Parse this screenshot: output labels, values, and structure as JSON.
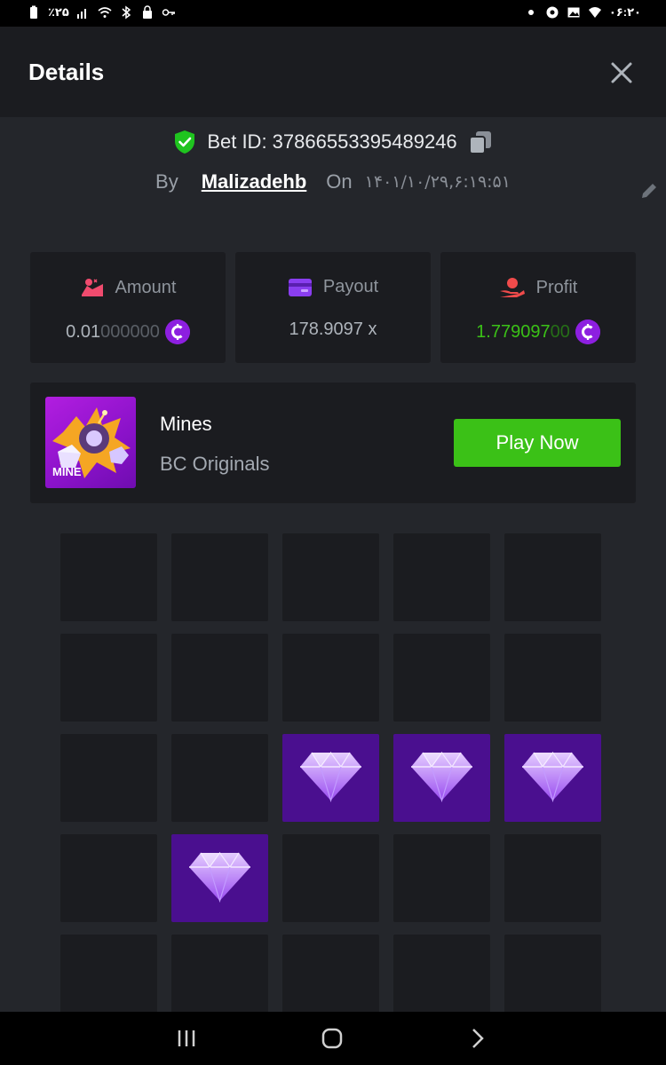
{
  "status_bar": {
    "battery": "٪۲۵",
    "time": "۰۶:۲۰"
  },
  "header": {
    "title": "Details",
    "close_icon": "close-icon"
  },
  "bet": {
    "id_text": "Bet ID: 37866553395489246",
    "by_label": "By",
    "username": "Malizadehb",
    "on_label": "On",
    "date": "۱۴۰۱/۱۰/۲۹,۶:۱۹:۵۱"
  },
  "stats": {
    "amount": {
      "label": "Amount",
      "value_main": "0.01",
      "value_dim": "000000"
    },
    "payout": {
      "label": "Payout",
      "value": "178.9097 x"
    },
    "profit": {
      "label": "Profit",
      "value_main": "1.779097",
      "value_dim": "00"
    }
  },
  "game": {
    "thumb_label": "MINE",
    "title": "Mines",
    "provider": "BC Originals",
    "play_label": "Play Now"
  },
  "grid": {
    "rows": [
      [
        "empty",
        "empty",
        "empty",
        "empty",
        "empty"
      ],
      [
        "empty",
        "empty",
        "empty",
        "empty",
        "empty"
      ],
      [
        "empty",
        "empty",
        "gem",
        "gem",
        "gem"
      ],
      [
        "empty",
        "gem",
        "empty",
        "empty",
        "empty"
      ],
      [
        "empty",
        "empty",
        "empty",
        "empty",
        "empty"
      ]
    ]
  },
  "colors": {
    "accent_green": "#3bc117",
    "gem_tile": "#4a0f8f",
    "coin": "#8d1fe0",
    "shield": "#1fc41f"
  }
}
